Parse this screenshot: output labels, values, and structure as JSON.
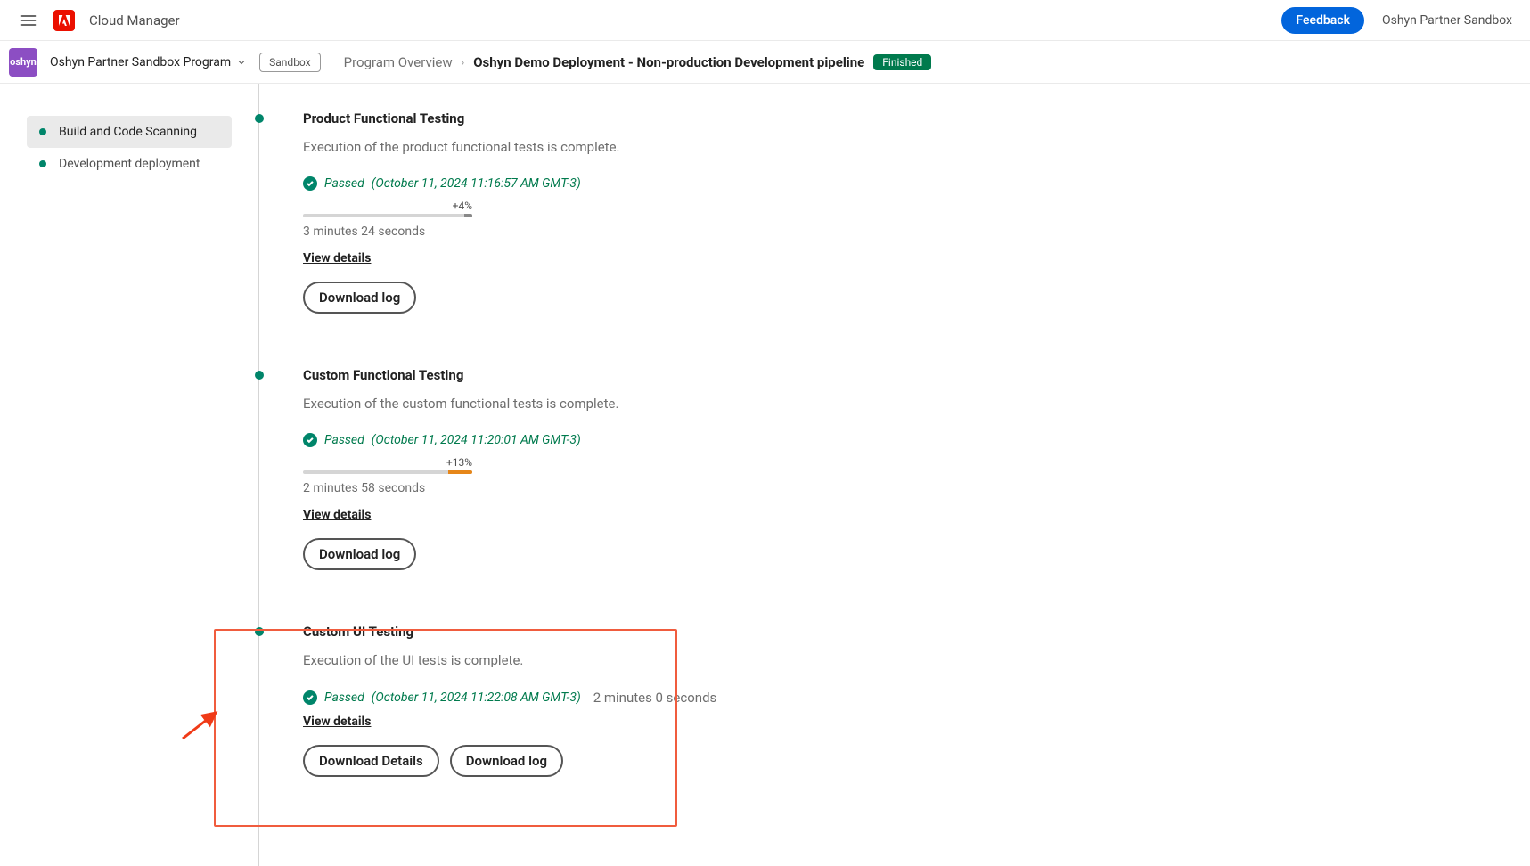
{
  "header": {
    "app_title": "Cloud Manager",
    "feedback_label": "Feedback",
    "account_name": "Oshyn Partner Sandbox",
    "program_badge_text": "oshyn",
    "program_name": "Oshyn Partner Sandbox Program",
    "sandbox_chip": "Sandbox"
  },
  "breadcrumb": {
    "root": "Program Overview",
    "current": "Oshyn Demo Deployment - Non-production Development pipeline",
    "status": "Finished"
  },
  "sidebar": {
    "items": [
      {
        "label": "Build and Code Scanning",
        "active": true
      },
      {
        "label": "Development deployment",
        "active": false
      }
    ]
  },
  "stages": [
    {
      "title": "Product Functional Testing",
      "desc": "Execution of the product functional tests is complete.",
      "status": "Passed",
      "timestamp": "(October 11, 2024 11:16:57 AM GMT-3)",
      "delta": "+4%",
      "progress_kind": "gray",
      "duration": "3 minutes 24 seconds",
      "duration_inline": false,
      "view_details": "View details",
      "buttons": [
        "Download log"
      ]
    },
    {
      "title": "Custom Functional Testing",
      "desc": "Execution of the custom functional tests is complete.",
      "status": "Passed",
      "timestamp": "(October 11, 2024 11:20:01 AM GMT-3)",
      "delta": "+13%",
      "progress_kind": "orange",
      "duration": "2 minutes 58 seconds",
      "duration_inline": false,
      "view_details": "View details",
      "buttons": [
        "Download log"
      ]
    },
    {
      "title": "Custom UI Testing",
      "desc": "Execution of the UI tests is complete.",
      "status": "Passed",
      "timestamp": "(October 11, 2024 11:22:08 AM GMT-3)",
      "delta": "",
      "progress_kind": "none",
      "duration": "2 minutes 0 seconds",
      "duration_inline": true,
      "view_details": "View details",
      "buttons": [
        "Download Details",
        "Download log"
      ]
    }
  ]
}
